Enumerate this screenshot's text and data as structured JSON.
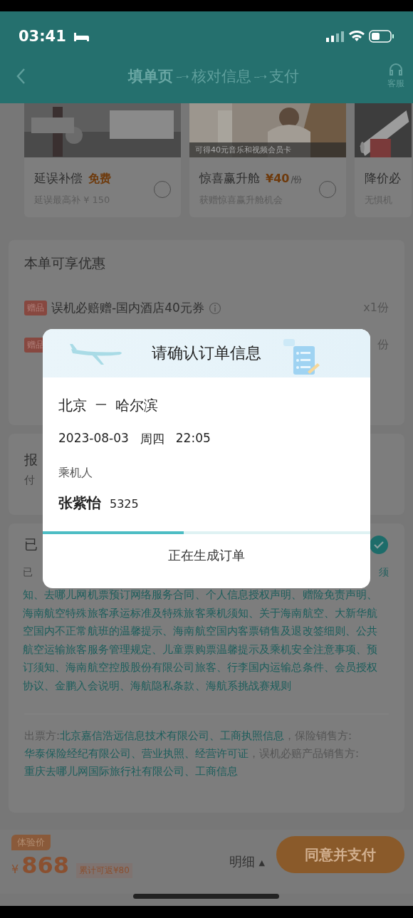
{
  "status_bar": {
    "time": "03:41"
  },
  "nav": {
    "steps": [
      {
        "label": "填单页",
        "selected": true
      },
      {
        "label": "核对信息",
        "selected": false
      },
      {
        "label": "支付",
        "selected": false
      }
    ],
    "arrow": "--➝",
    "service": "客服"
  },
  "products": [
    {
      "title": "延误补偿",
      "price": "免费",
      "desc": "延误最高补 ¥ 150",
      "checked": false
    },
    {
      "title": "惊喜赢升舱",
      "price": "¥40",
      "unit": "/份",
      "caption": "可得40元音乐和视频会员卡",
      "desc": "获赠惊喜赢升舱机会",
      "checked": false
    },
    {
      "title": "降价必",
      "desc": "无惧机"
    }
  ],
  "offers": {
    "title": "本单可享优惠",
    "items": [
      {
        "tag": "赠品",
        "text": "误机必赔赠-国内酒店40元券",
        "qty": "x1份"
      },
      {
        "tag": "赠品",
        "qty": "份"
      }
    ]
  },
  "reimburse": {
    "title": "报",
    "sub": "付"
  },
  "agreement": {
    "title": "已",
    "checked": true,
    "lead": "已",
    "lead_tail": "须",
    "links": "知、去哪儿网机票预订网络服务合同、个人信息授权声明、赠险免责声明、海南航空特殊旅客承运标准及特殊旅客乘机须知、关于海南航空、大新华航空国内不正常航班的温馨提示、海南航空国内客票销售及退改签细则、公共航空运输旅客服务管理规定、儿童票购票温馨提示及乘机安全注意事项、预订须知、海南航空控股股份有限公司旅客、行李国内运输总条件、会员授权协议、金鹏入会说明、海航隐私条款、海航系挑战赛规则",
    "issuer": [
      {
        "kind": "label",
        "text": "出票方:"
      },
      {
        "kind": "link",
        "text": "北京嘉信浩远信息技术有限公司"
      },
      {
        "kind": "link",
        "text": "、工商执照信息"
      },
      {
        "kind": "label",
        "text": "，保险销售方:"
      },
      {
        "kind": "link",
        "text": "华泰保险经纪有限公司"
      },
      {
        "kind": "link",
        "text": "、营业执照"
      },
      {
        "kind": "link",
        "text": "、经营许可证"
      },
      {
        "kind": "label",
        "text": "，误机必赔产品销售方:"
      },
      {
        "kind": "link",
        "text": "重庆去哪儿网国际旅行社有限公司"
      },
      {
        "kind": "link",
        "text": "、工商信息"
      }
    ]
  },
  "footer": {
    "price_tag": "体验价",
    "currency": "¥",
    "price": "868",
    "cashback": "累计可返¥80",
    "detail": "明细",
    "detail_caret": "▲",
    "pay": "同意并支付"
  },
  "dialog": {
    "title": "请确认订单信息",
    "route_from": "北京",
    "route_sep": "一",
    "route_to": "哈尔滨",
    "date": "2023-08-03",
    "weekday": "周四",
    "time": "22:05",
    "passenger_label": "乘机人",
    "passenger_name": "张紫怡",
    "passenger_id": "5325",
    "level": 0.43,
    "status": "正在生成订单"
  }
}
